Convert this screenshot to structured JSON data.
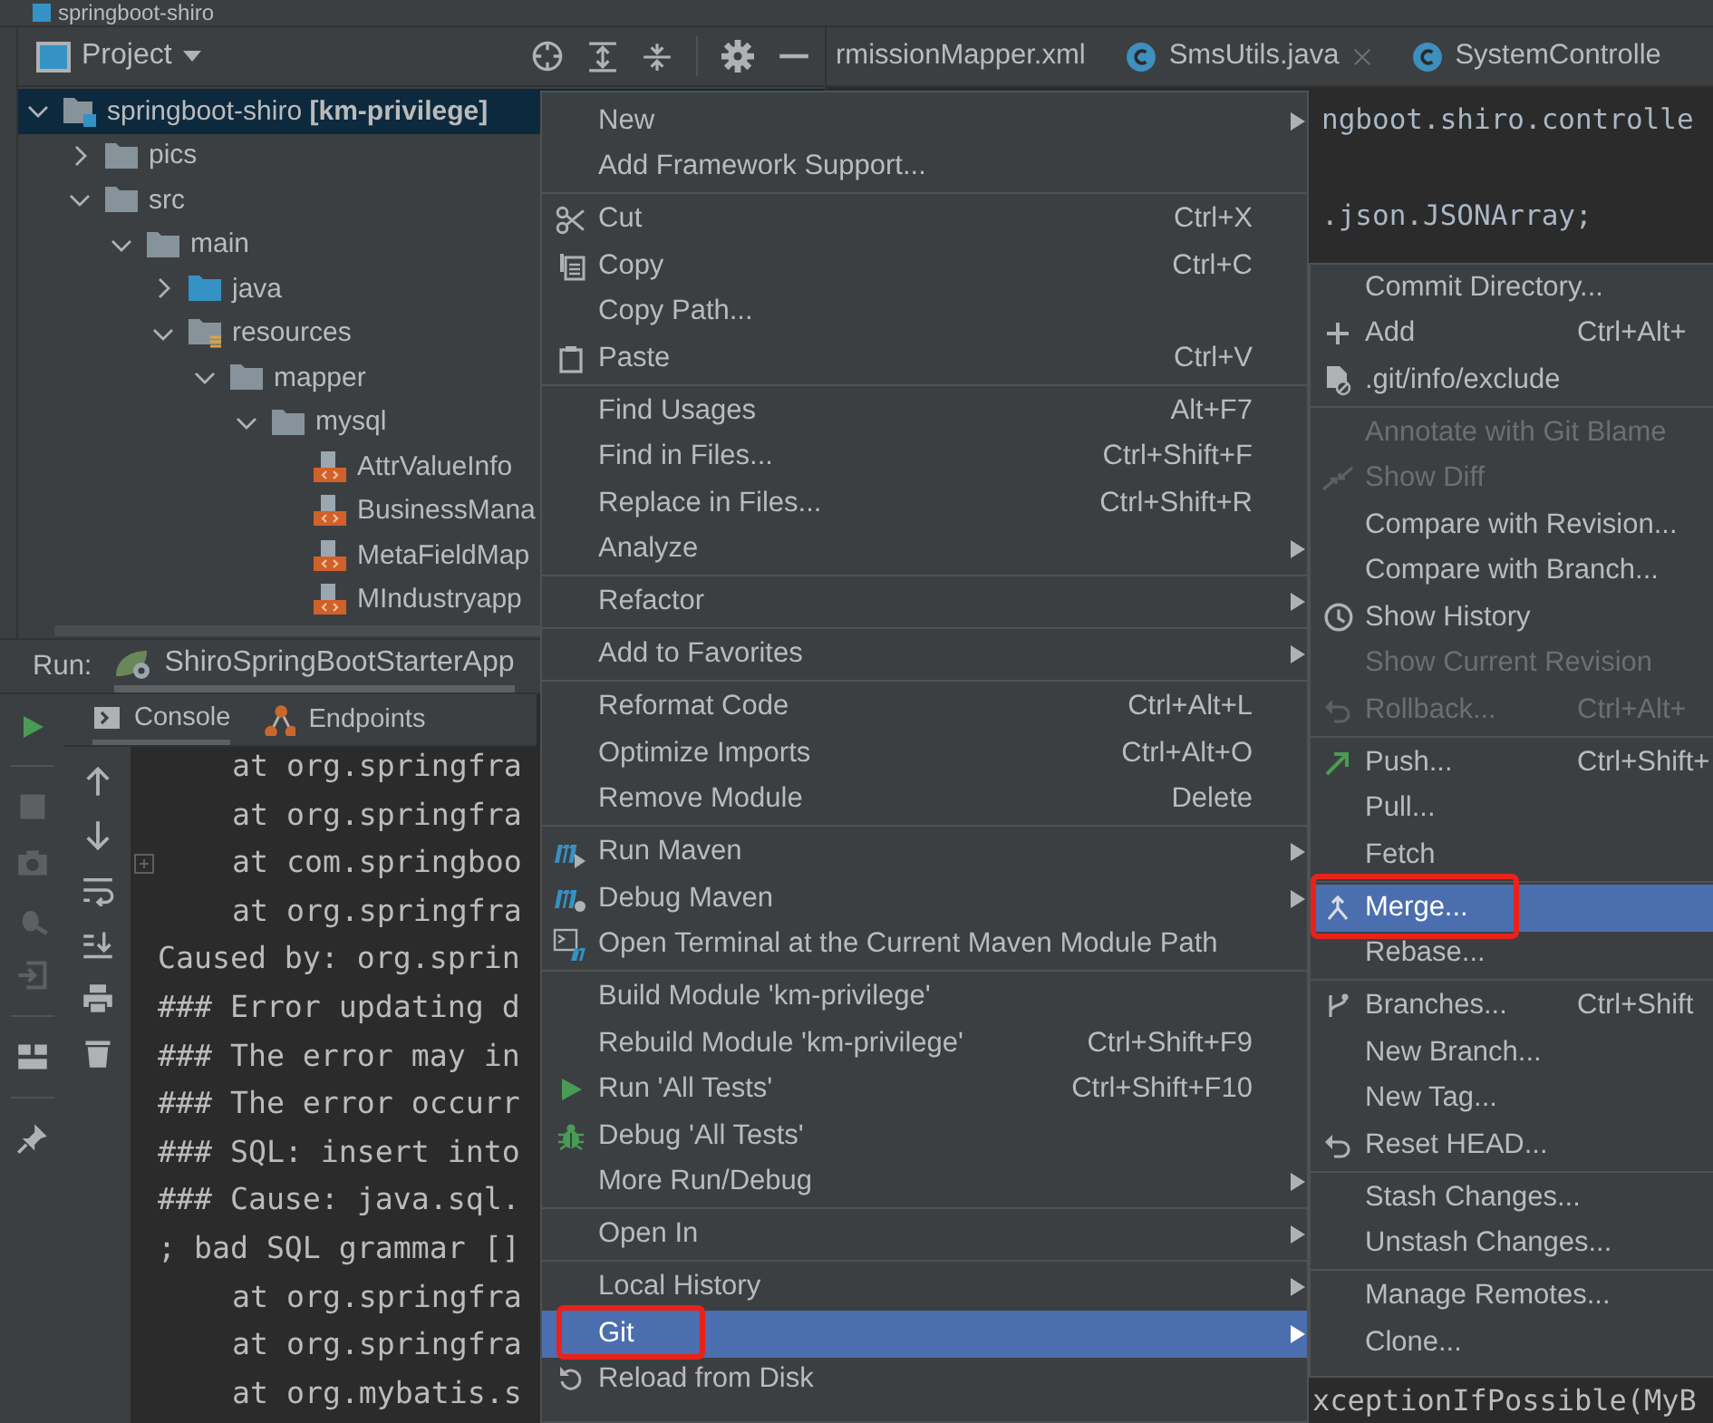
{
  "window": {
    "title": "springboot-shiro"
  },
  "project_panel": {
    "title": "Project",
    "tree": [
      {
        "kind": "module",
        "label": "springboot-shiro **[km-privilege]**",
        "expanded": true,
        "selected": true,
        "children": [
          {
            "kind": "folder",
            "label": "pics",
            "expanded": false,
            "selected": false
          },
          {
            "kind": "folder",
            "label": "src",
            "expanded": true,
            "selected": false,
            "children": [
              {
                "kind": "folder",
                "label": "main",
                "expanded": true,
                "selected": false,
                "children": [
                  {
                    "kind": "source_folder",
                    "label": "java",
                    "expanded": false,
                    "selected": false
                  },
                  {
                    "kind": "resource_folder",
                    "label": "resources",
                    "expanded": true,
                    "selected": false,
                    "children": [
                      {
                        "kind": "folder",
                        "label": "mapper",
                        "expanded": true,
                        "selected": false,
                        "children": [
                          {
                            "kind": "folder",
                            "label": "mysql",
                            "expanded": true,
                            "selected": false,
                            "children": [
                              {
                                "kind": "xml_file",
                                "label": "AttrValueInfo",
                                "selected": false
                              },
                              {
                                "kind": "xml_file",
                                "label": "BusinessMana",
                                "selected": false
                              },
                              {
                                "kind": "xml_file",
                                "label": "MetaFieldMap",
                                "selected": false
                              },
                              {
                                "kind": "xml_file",
                                "label": "MIndustryapp",
                                "selected": false
                              }
                            ]
                          }
                        ]
                      }
                    ]
                  }
                ]
              }
            ]
          }
        ]
      }
    ]
  },
  "editor": {
    "tabs": [
      {
        "kind": "plain",
        "label": "rmissionMapper.xml",
        "selected": false,
        "closable": false
      },
      {
        "kind": "class",
        "label": "SmsUtils.java",
        "selected": false,
        "closable": true
      },
      {
        "kind": "class",
        "label": "SystemControlle",
        "selected": false,
        "closable": false
      }
    ],
    "code_lines": [
      "ngboot.shiro.controlle",
      ".json.JSONArray;"
    ]
  },
  "run_panel": {
    "label": "Run:",
    "tabs": [
      {
        "label": "ShiroSpringBootStarterApp",
        "selected": true
      }
    ],
    "subtabs": [
      {
        "kind": "console",
        "label": "Console",
        "selected": true
      },
      {
        "kind": "endpoints",
        "label": "Endpoints",
        "selected": false
      }
    ],
    "console_lines": [
      {
        "text": "at org.springfra",
        "indented": true,
        "fold_marker": false
      },
      {
        "text": "at org.springfra",
        "indented": true,
        "fold_marker": false
      },
      {
        "text": "at com.springboo",
        "indented": true,
        "fold_marker": true
      },
      {
        "text": "at org.springfra",
        "indented": true,
        "fold_marker": false
      },
      {
        "text": "Caused by: org.sprin",
        "indented": false,
        "fold_marker": false
      },
      {
        "text": "### Error updating d",
        "indented": false,
        "fold_marker": false
      },
      {
        "text": "### The error may in",
        "indented": false,
        "fold_marker": false
      },
      {
        "text": "### The error occurr",
        "indented": false,
        "fold_marker": false
      },
      {
        "text": "### SQL: insert into",
        "indented": false,
        "fold_marker": false
      },
      {
        "text": "### Cause: java.sql.",
        "indented": false,
        "fold_marker": false
      },
      {
        "text": "; bad SQL grammar []",
        "indented": false,
        "fold_marker": false
      },
      {
        "text": "at org.springfra",
        "indented": true,
        "fold_marker": false
      },
      {
        "text": "at org.springfra",
        "indented": true,
        "fold_marker": false
      },
      {
        "text": "at org.mybatis.s",
        "indented": true,
        "fold_marker": false
      }
    ],
    "console_fragment": "xceptionIfPossible(MyB"
  },
  "context_menu": {
    "groups": [
      {
        "items": [
          {
            "label": "New",
            "submenu": true,
            "selected": false,
            "disabled": false,
            "callout": false
          },
          {
            "label": "Add Framework Support...",
            "submenu": false,
            "selected": false,
            "disabled": false,
            "callout": false
          }
        ]
      },
      {
        "items": [
          {
            "label": "Cut",
            "shortcut": "Ctrl+X",
            "submenu": false,
            "selected": false,
            "disabled": false,
            "callout": false
          },
          {
            "label": "Copy",
            "shortcut": "Ctrl+C",
            "submenu": false,
            "selected": false,
            "disabled": false,
            "callout": false
          },
          {
            "label": "Copy Path...",
            "submenu": false,
            "selected": false,
            "disabled": false,
            "callout": false
          },
          {
            "label": "Paste",
            "shortcut": "Ctrl+V",
            "submenu": false,
            "selected": false,
            "disabled": false,
            "callout": false
          }
        ]
      },
      {
        "items": [
          {
            "label": "Find Usages",
            "shortcut": "Alt+F7",
            "submenu": false,
            "selected": false,
            "disabled": false,
            "callout": false
          },
          {
            "label": "Find in Files...",
            "shortcut": "Ctrl+Shift+F",
            "submenu": false,
            "selected": false,
            "disabled": false,
            "callout": false
          },
          {
            "label": "Replace in Files...",
            "shortcut": "Ctrl+Shift+R",
            "submenu": false,
            "selected": false,
            "disabled": false,
            "callout": false
          },
          {
            "label": "Analyze",
            "submenu": true,
            "selected": false,
            "disabled": false,
            "callout": false
          }
        ]
      },
      {
        "items": [
          {
            "label": "Refactor",
            "submenu": true,
            "selected": false,
            "disabled": false,
            "callout": false
          }
        ]
      },
      {
        "items": [
          {
            "label": "Add to Favorites",
            "submenu": true,
            "selected": false,
            "disabled": false,
            "callout": false
          }
        ]
      },
      {
        "items": [
          {
            "label": "Reformat Code",
            "shortcut": "Ctrl+Alt+L",
            "submenu": false,
            "selected": false,
            "disabled": false,
            "callout": false
          },
          {
            "label": "Optimize Imports",
            "shortcut": "Ctrl+Alt+O",
            "submenu": false,
            "selected": false,
            "disabled": false,
            "callout": false
          },
          {
            "label": "Remove Module",
            "shortcut": "Delete",
            "submenu": false,
            "selected": false,
            "disabled": false,
            "callout": false
          }
        ]
      },
      {
        "items": [
          {
            "label": "Run Maven",
            "submenu": true,
            "selected": false,
            "disabled": false,
            "callout": false
          },
          {
            "label": "Debug Maven",
            "submenu": true,
            "selected": false,
            "disabled": false,
            "callout": false
          },
          {
            "label": "Open Terminal at the Current Maven Module Path",
            "submenu": false,
            "selected": false,
            "disabled": false,
            "callout": false
          }
        ]
      },
      {
        "items": [
          {
            "label": "Build Module 'km-privilege'",
            "submenu": false,
            "selected": false,
            "disabled": false,
            "callout": false
          },
          {
            "label": "Rebuild Module 'km-privilege'",
            "shortcut": "Ctrl+Shift+F9",
            "submenu": false,
            "selected": false,
            "disabled": false,
            "callout": false
          },
          {
            "label": "Run 'All Tests'",
            "shortcut": "Ctrl+Shift+F10",
            "submenu": false,
            "selected": false,
            "disabled": false,
            "callout": false
          },
          {
            "label": "Debug 'All Tests'",
            "submenu": false,
            "selected": false,
            "disabled": false,
            "callout": false
          },
          {
            "label": "More Run/Debug",
            "submenu": true,
            "selected": false,
            "disabled": false,
            "callout": false
          }
        ]
      },
      {
        "items": [
          {
            "label": "Open In",
            "submenu": true,
            "selected": false,
            "disabled": false,
            "callout": false
          }
        ]
      },
      {
        "items": [
          {
            "label": "Local History",
            "submenu": true,
            "selected": false,
            "disabled": false,
            "callout": false
          },
          {
            "label": "Git",
            "submenu": true,
            "selected": true,
            "disabled": false,
            "callout": true
          },
          {
            "label": "Reload from Disk",
            "submenu": false,
            "selected": false,
            "disabled": false,
            "callout": false
          }
        ]
      }
    ]
  },
  "git_submenu": {
    "groups": [
      {
        "items": [
          {
            "label": "Commit Directory...",
            "selected": false,
            "disabled": false,
            "callout": false
          },
          {
            "label": "Add",
            "shortcut": "Ctrl+Alt+",
            "selected": false,
            "disabled": false,
            "callout": false
          },
          {
            "label": ".git/info/exclude",
            "selected": false,
            "disabled": false,
            "callout": false
          }
        ]
      },
      {
        "items": [
          {
            "label": "Annotate with Git Blame",
            "selected": false,
            "disabled": true,
            "callout": false
          },
          {
            "label": "Show Diff",
            "selected": false,
            "disabled": true,
            "callout": false
          },
          {
            "label": "Compare with Revision...",
            "selected": false,
            "disabled": false,
            "callout": false
          },
          {
            "label": "Compare with Branch...",
            "selected": false,
            "disabled": false,
            "callout": false
          },
          {
            "label": "Show History",
            "selected": false,
            "disabled": false,
            "callout": false
          },
          {
            "label": "Show Current Revision",
            "selected": false,
            "disabled": true,
            "callout": false
          },
          {
            "label": "Rollback...",
            "shortcut": "Ctrl+Alt+",
            "selected": false,
            "disabled": true,
            "callout": false
          }
        ]
      },
      {
        "items": [
          {
            "label": "Push...",
            "shortcut": "Ctrl+Shift+",
            "selected": false,
            "disabled": false,
            "callout": false
          },
          {
            "label": "Pull...",
            "selected": false,
            "disabled": false,
            "callout": false
          },
          {
            "label": "Fetch",
            "selected": false,
            "disabled": false,
            "callout": false
          }
        ]
      },
      {
        "items": [
          {
            "label": "Merge...",
            "selected": true,
            "disabled": false,
            "callout": true
          },
          {
            "label": "Rebase...",
            "selected": false,
            "disabled": false,
            "callout": false
          }
        ]
      },
      {
        "items": [
          {
            "label": "Branches...",
            "shortcut": "Ctrl+Shift",
            "selected": false,
            "disabled": false,
            "callout": false
          },
          {
            "label": "New Branch...",
            "selected": false,
            "disabled": false,
            "callout": false
          },
          {
            "label": "New Tag...",
            "selected": false,
            "disabled": false,
            "callout": false
          },
          {
            "label": "Reset HEAD...",
            "selected": false,
            "disabled": false,
            "callout": false
          }
        ]
      },
      {
        "items": [
          {
            "label": "Stash Changes...",
            "selected": false,
            "disabled": false,
            "callout": false
          },
          {
            "label": "Unstash Changes...",
            "selected": false,
            "disabled": false,
            "callout": false
          }
        ]
      },
      {
        "items": [
          {
            "label": "Manage Remotes...",
            "selected": false,
            "disabled": false,
            "callout": false
          },
          {
            "label": "Clone...",
            "selected": false,
            "disabled": false,
            "callout": false
          }
        ]
      }
    ]
  }
}
